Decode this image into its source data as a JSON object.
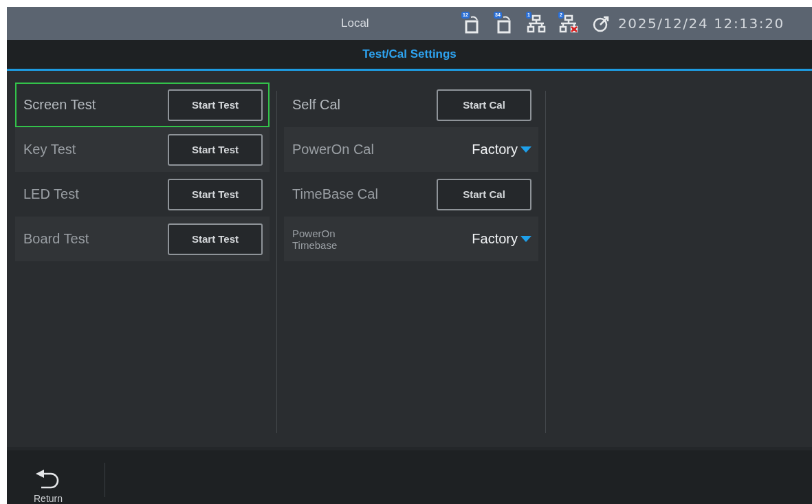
{
  "status_bar": {
    "mode": "Local",
    "indicators": [
      {
        "kind": "usb",
        "badge": "12"
      },
      {
        "kind": "usb",
        "badge": "34"
      },
      {
        "kind": "network",
        "badge": "1",
        "error": false
      },
      {
        "kind": "network",
        "badge": "2",
        "error": true
      },
      {
        "kind": "gps"
      }
    ],
    "datetime": "2025/12/24 12:13:20"
  },
  "title": "Test/Cal Settings",
  "columns": [
    {
      "rows": [
        {
          "kind": "button",
          "label": "Screen Test",
          "button": "Start Test",
          "selected": true
        },
        {
          "kind": "button",
          "label": "Key Test",
          "button": "Start Test",
          "selected": false
        },
        {
          "kind": "button",
          "label": "LED Test",
          "button": "Start Test",
          "selected": false
        },
        {
          "kind": "button",
          "label": "Board Test",
          "button": "Start Test",
          "selected": false
        }
      ]
    },
    {
      "rows": [
        {
          "kind": "button",
          "label": "Self Cal",
          "button": "Start Cal",
          "selected": false
        },
        {
          "kind": "select",
          "label": "PowerOn Cal",
          "value": "Factory",
          "selected": false
        },
        {
          "kind": "button",
          "label": "TimeBase Cal",
          "button": "Start Cal",
          "selected": false
        },
        {
          "kind": "select",
          "label": "PowerOn Timebase",
          "value": "Factory",
          "selected": false,
          "small": true
        }
      ]
    }
  ],
  "bottom_bar": {
    "return_label": "Return"
  }
}
